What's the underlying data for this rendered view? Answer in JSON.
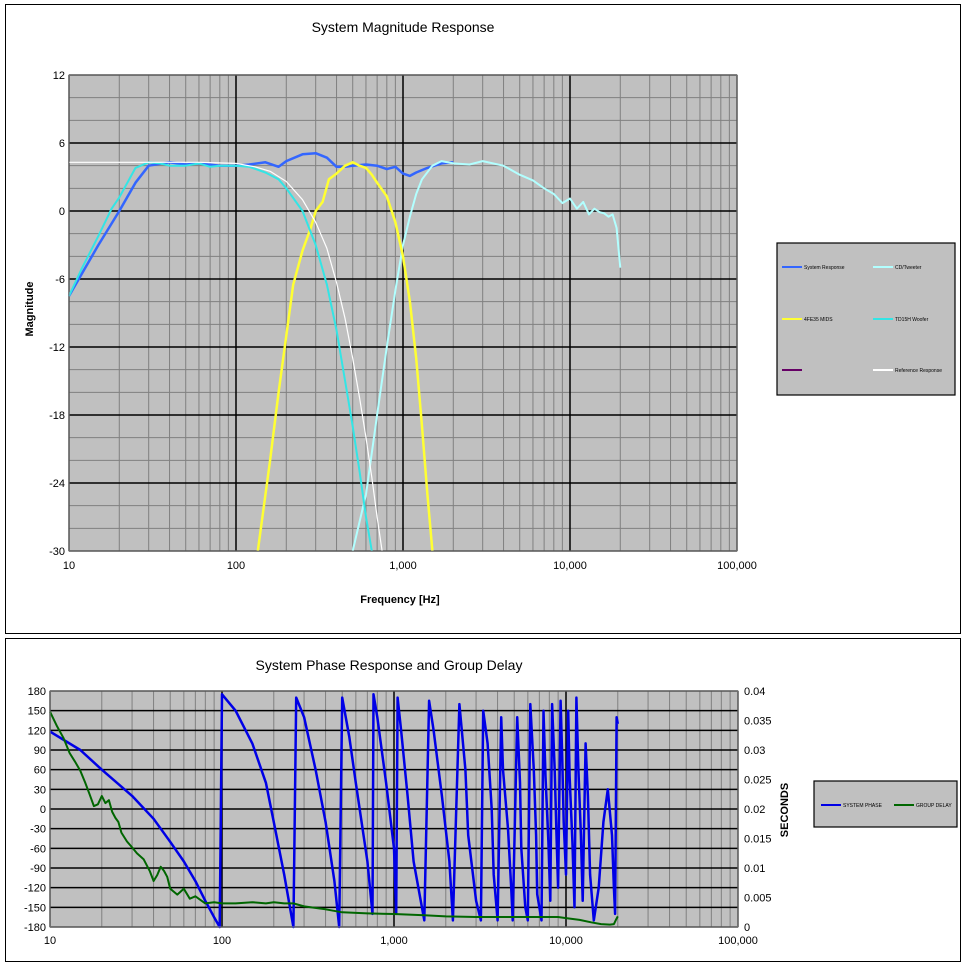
{
  "chart_data": [
    {
      "type": "line",
      "title": "System Magnitude Response",
      "xlabel": "Frequency [Hz]",
      "ylabel": "Magnitude",
      "xscale": "log",
      "xlim": [
        10,
        100000
      ],
      "ylim": [
        -30,
        12
      ],
      "grid": true,
      "background": "#c0c0c0",
      "xticks": [
        10,
        100,
        1000,
        10000,
        100000
      ],
      "xtick_labels": [
        "10",
        "100",
        "1,000",
        "10,000",
        "100,000"
      ],
      "yticks": [
        -30,
        -24,
        -18,
        -12,
        -6,
        0,
        6,
        12
      ],
      "ytick_labels": [
        "-30",
        "-24",
        "-18",
        "-12",
        "-6",
        "0",
        "6",
        "12"
      ],
      "legend_position": "right",
      "series": [
        {
          "name": "System Response",
          "color": "#3366ff",
          "width": 2.5,
          "x": [
            10,
            15,
            20,
            25,
            30,
            40,
            50,
            60,
            80,
            100,
            120,
            150,
            180,
            200,
            250,
            300,
            350,
            400,
            450,
            500,
            600,
            700,
            800,
            900,
            1000,
            1100,
            1200,
            1400,
            1700,
            2000
          ],
          "y": [
            -7.5,
            -3,
            0,
            2.5,
            4,
            4.3,
            4.1,
            4.2,
            4.0,
            4.0,
            4.1,
            4.3,
            3.9,
            4.4,
            5.0,
            5.1,
            4.7,
            3.9,
            3.9,
            4.0,
            4.1,
            4.0,
            3.7,
            3.9,
            3.3,
            3.1,
            3.4,
            3.8,
            4.2,
            4.3
          ]
        },
        {
          "name": "CD/Tweeter",
          "color": "#b2ffff",
          "width": 2,
          "x": [
            500,
            600,
            700,
            800,
            900,
            1000,
            1100,
            1200,
            1300,
            1500,
            1700,
            2000,
            2500,
            3000,
            4000,
            5000,
            6000,
            7000,
            8000,
            9000,
            10000,
            11000,
            12000,
            13000,
            14000,
            15000,
            16000,
            17000,
            18000,
            19000,
            20000
          ],
          "y": [
            -30,
            -25,
            -18,
            -12,
            -7,
            -3,
            -0.5,
            1.5,
            2.8,
            4.0,
            4.4,
            4.2,
            4.1,
            4.4,
            4.0,
            3.2,
            2.7,
            2.0,
            1.5,
            0.7,
            1.1,
            0.2,
            0.8,
            -0.3,
            0.2,
            -0.1,
            -0.2,
            -0.5,
            -0.3,
            -1.5,
            -5
          ]
        },
        {
          "name": "4FE35 MIDS",
          "color": "#ffff33",
          "width": 2.5,
          "x": [
            135,
            160,
            180,
            200,
            220,
            250,
            280,
            300,
            330,
            360,
            400,
            450,
            500,
            550,
            600,
            650,
            700,
            800,
            900,
            1000,
            1100,
            1200,
            1300,
            1400,
            1500
          ],
          "y": [
            -30,
            -22,
            -16,
            -11,
            -6.5,
            -3.5,
            -1.5,
            0,
            0.8,
            2.8,
            3.3,
            4.0,
            4.3,
            4.0,
            3.8,
            3.2,
            2.5,
            1.3,
            -1,
            -4,
            -8,
            -13,
            -19,
            -25,
            -30
          ]
        },
        {
          "name": "TD15H Woofer",
          "color": "#33e5e5",
          "width": 2,
          "x": [
            10,
            12,
            15,
            18,
            20,
            25,
            30,
            35,
            40,
            50,
            60,
            70,
            80,
            100,
            120,
            150,
            180,
            200,
            250,
            300,
            350,
            400,
            450,
            500,
            550,
            600,
            650
          ],
          "y": [
            -7.5,
            -5,
            -2.2,
            0.2,
            1.2,
            3.8,
            4.3,
            4.2,
            4.0,
            4.0,
            4.2,
            3.9,
            4.0,
            4.0,
            3.9,
            3.4,
            2.8,
            2.0,
            0,
            -3,
            -6.5,
            -10.5,
            -15,
            -19,
            -23,
            -27,
            -30
          ]
        },
        {
          "name": "",
          "color": "#660066",
          "width": 2,
          "x": [],
          "y": []
        },
        {
          "name": "Reference Response",
          "color": "#ffffff",
          "width": 1.2,
          "x": [
            10,
            30,
            60,
            100,
            130,
            160,
            200,
            250,
            300,
            350,
            400,
            450,
            500,
            550,
            600,
            650,
            700,
            750
          ],
          "y": [
            4.3,
            4.3,
            4.3,
            4.2,
            3.9,
            3.5,
            2.6,
            1.0,
            -1.0,
            -3.3,
            -6.3,
            -9.5,
            -13,
            -16.5,
            -20,
            -23.5,
            -27,
            -30
          ]
        }
      ]
    },
    {
      "type": "line",
      "title": "System Phase Response and Group Delay",
      "xlabel": "",
      "ylabel": "",
      "y2label": "SECONDS",
      "xscale": "log",
      "xlim": [
        10,
        100000
      ],
      "ylim": [
        -180,
        180
      ],
      "y2lim": [
        0,
        0.04
      ],
      "grid": true,
      "background": "#c0c0c0",
      "xticks": [
        10,
        100,
        1000,
        10000,
        100000
      ],
      "xtick_labels": [
        "10",
        "100",
        "1,000",
        "10,000",
        "100,000"
      ],
      "yticks": [
        -180,
        -150,
        -120,
        -90,
        -60,
        -30,
        0,
        30,
        60,
        90,
        120,
        150,
        180
      ],
      "ytick_labels": [
        "-180",
        "-150",
        "-120",
        "-90",
        "-60",
        "-30",
        "0",
        "30",
        "60",
        "90",
        "120",
        "150",
        "180"
      ],
      "y2ticks": [
        0,
        0.005,
        0.01,
        0.015,
        0.02,
        0.025,
        0.03,
        0.035,
        0.04
      ],
      "y2tick_labels": [
        "0",
        "0.005",
        "0.01",
        "0.015",
        "0.02",
        "0.025",
        "0.03",
        "0.035",
        "0.04"
      ],
      "legend_position": "right",
      "series": [
        {
          "name": "SYSTEM PHASE",
          "color": "#0000e6",
          "width": 2.5,
          "axis": "y",
          "x": [
            10,
            15,
            20,
            30,
            40,
            50,
            60,
            70,
            80,
            90,
            97,
            100,
            120,
            150,
            180,
            200,
            230,
            260,
            270,
            300,
            350,
            400,
            450,
            480,
            500,
            550,
            600,
            700,
            750,
            760,
            800,
            900,
            1000,
            1030,
            1050,
            1100,
            1200,
            1300,
            1500,
            1600,
            1700,
            1900,
            2100,
            2200,
            2400,
            2600,
            2700,
            3000,
            3200,
            3300,
            3500,
            3700,
            3800,
            4000,
            4200,
            4300,
            4600,
            4800,
            4900,
            5200,
            5400,
            5500,
            5800,
            6000,
            6200,
            6500,
            6700,
            6800,
            7200,
            7400,
            7600,
            7900,
            8100,
            8300,
            8600,
            8800,
            9000,
            9300,
            9500,
            9700,
            10000,
            10300,
            10500,
            10900,
            11200,
            11500,
            11800,
            12200,
            12500,
            13000,
            13400,
            13800,
            14500,
            15500,
            16500,
            17500,
            18500,
            19000,
            19300,
            19700,
            20000
          ],
          "y": [
            118,
            90,
            60,
            20,
            -15,
            -50,
            -80,
            -110,
            -140,
            -165,
            -180,
            175,
            150,
            100,
            40,
            -20,
            -100,
            -180,
            170,
            140,
            60,
            -20,
            -110,
            -180,
            170,
            110,
            40,
            -80,
            -160,
            175,
            140,
            40,
            -60,
            -160,
            170,
            120,
            20,
            -80,
            -170,
            165,
            120,
            20,
            -80,
            -170,
            160,
            60,
            -40,
            -140,
            -170,
            150,
            100,
            0,
            -100,
            -170,
            140,
            60,
            -30,
            -120,
            -170,
            140,
            40,
            -60,
            -150,
            -170,
            160,
            60,
            -40,
            -130,
            -170,
            150,
            50,
            -50,
            -140,
            160,
            60,
            -40,
            -120,
            165,
            80,
            -20,
            -100,
            150,
            50,
            -50,
            -150,
            170,
            60,
            -40,
            -140,
            100,
            20,
            -100,
            -170,
            -120,
            -20,
            30,
            -40,
            -120,
            -160,
            140,
            130
          ]
        },
        {
          "name": "GROUP DELAY",
          "color": "#006600",
          "width": 2,
          "axis": "y2",
          "x": [
            10,
            11,
            12,
            13,
            14,
            15,
            16,
            17,
            18,
            19,
            20,
            21,
            22,
            23,
            24,
            25,
            26,
            28,
            30,
            32,
            35,
            38,
            40,
            42,
            44,
            46,
            48,
            50,
            55,
            60,
            65,
            70,
            80,
            90,
            100,
            120,
            150,
            180,
            200,
            230,
            260,
            300,
            400,
            500,
            700,
            1000,
            1500,
            2000,
            3000,
            5000,
            7000,
            9000,
            10000,
            12000,
            14000,
            16000,
            18000,
            19000,
            19500,
            20000
          ],
          "y": [
            0.0365,
            0.034,
            0.032,
            0.0295,
            0.028,
            0.0265,
            0.0245,
            0.0225,
            0.0205,
            0.0208,
            0.0222,
            0.021,
            0.0215,
            0.0195,
            0.0185,
            0.0178,
            0.016,
            0.0145,
            0.0135,
            0.0125,
            0.0115,
            0.0095,
            0.0078,
            0.0088,
            0.0102,
            0.0095,
            0.0085,
            0.0065,
            0.0055,
            0.0065,
            0.0048,
            0.0052,
            0.004,
            0.0042,
            0.004,
            0.004,
            0.0042,
            0.004,
            0.0042,
            0.004,
            0.004,
            0.0035,
            0.003,
            0.0025,
            0.0023,
            0.0022,
            0.002,
            0.0018,
            0.0017,
            0.0017,
            0.0017,
            0.0017,
            0.0015,
            0.0012,
            0.0008,
            0.0005,
            0.0004,
            0.0005,
            0.0012,
            0.0018
          ]
        }
      ]
    }
  ]
}
